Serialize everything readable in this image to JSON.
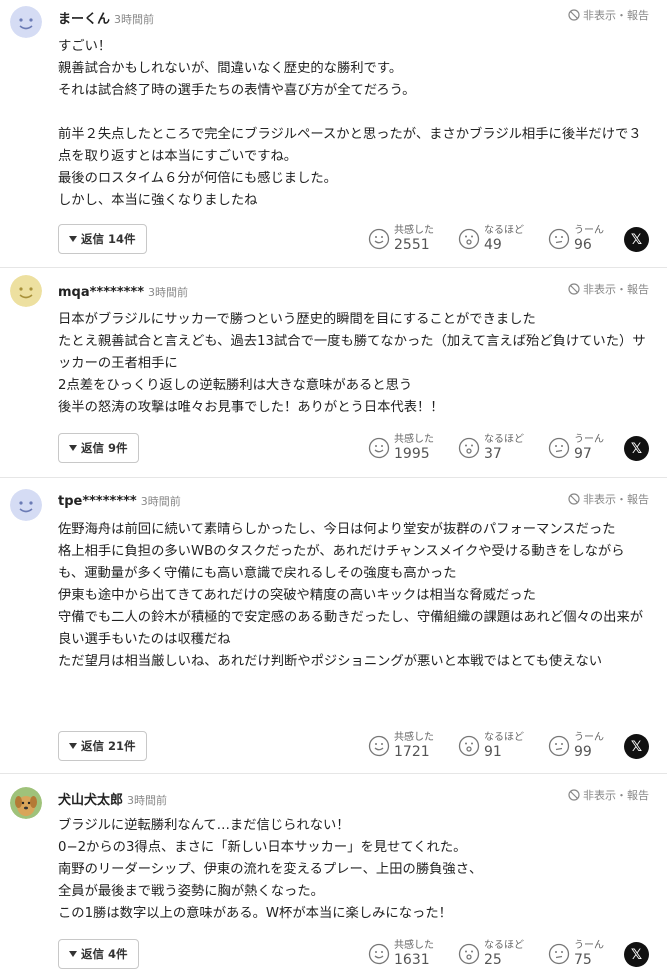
{
  "ui": {
    "hide_report": "非表示・報告",
    "reactions": [
      "共感した",
      "なるほど",
      "うーん"
    ],
    "x_label": "𝕏"
  },
  "comments": [
    {
      "user": "まーくん",
      "time": "3時間前",
      "avatar": "face-blue",
      "text": "すごい！\n親善試合かもしれないが、間違いなく歴史的な勝利です。\nそれは試合終了時の選手たちの表情や喜び方が全てだろう。\n\n前半２失点したところで完全にブラジルペースかと思ったが、まさかブラジル相手に後半だけで３点を取り返すとは本当にすごいですね。\n最後のロスタイム６分が何倍にも感じました。\nしかし、本当に強くなりましたね",
      "reply": "返信 14件",
      "counts": [
        "2551",
        "49",
        "96"
      ]
    },
    {
      "user": "mqa********",
      "time": "3時間前",
      "avatar": "face-yellow",
      "text": "日本がブラジルにサッカーで勝つという歴史的瞬間を目にすることができました\nたとえ親善試合と言えども、過去13試合で一度も勝てなかった（加えて言えば殆ど負けていた）サッカーの王者相手に\n2点差をひっくり返しの逆転勝利は大きな意味があると思う\n後半の怒涛の攻撃は唯々お見事でした！ありがとう日本代表！！",
      "reply": "返信 9件",
      "counts": [
        "1995",
        "37",
        "97"
      ]
    },
    {
      "user": "tpe********",
      "time": "3時間前",
      "avatar": "face-blue",
      "text": "佐野海舟は前回に続いて素晴らしかったし、今日は何より堂安が抜群のパフォーマンスだった\n格上相手に負担の多いWBのタスクだったが、あれだけチャンスメイクや受ける動きをしながらも、運動量が多く守備にも高い意識で戻れるしその強度も高かった\n伊東も途中から出てきてあれだけの突破や精度の高いキックは相当な脅威だった\n守備でも二人の鈴木が積極的で安定感のある動きだったし、守備組織の課題はあれど個々の出来が良い選手もいたのは収穫だね\nただ望月は相当厳しいね、あれだけ判断やポジショニングが悪いと本戦ではとても使えない",
      "reply": "返信 21件",
      "counts": [
        "1721",
        "91",
        "99"
      ]
    },
    {
      "user": "犬山犬太郎",
      "time": "3時間前",
      "avatar": "dog-photo",
      "text": "ブラジルに逆転勝利なんて…まだ信じられない！\n0−2からの3得点、まさに「新しい日本サッカー」を見せてくれた。\n南野のリーダーシップ、伊東の流れを変えるプレー、上田の勝負強さ、\n全員が最後まで戦う姿勢に胸が熱くなった。\nこの1勝は数字以上の意味がある。W杯が本当に楽しみになった！",
      "reply": "返信 4件",
      "counts": [
        "1631",
        "25",
        "75"
      ]
    }
  ]
}
